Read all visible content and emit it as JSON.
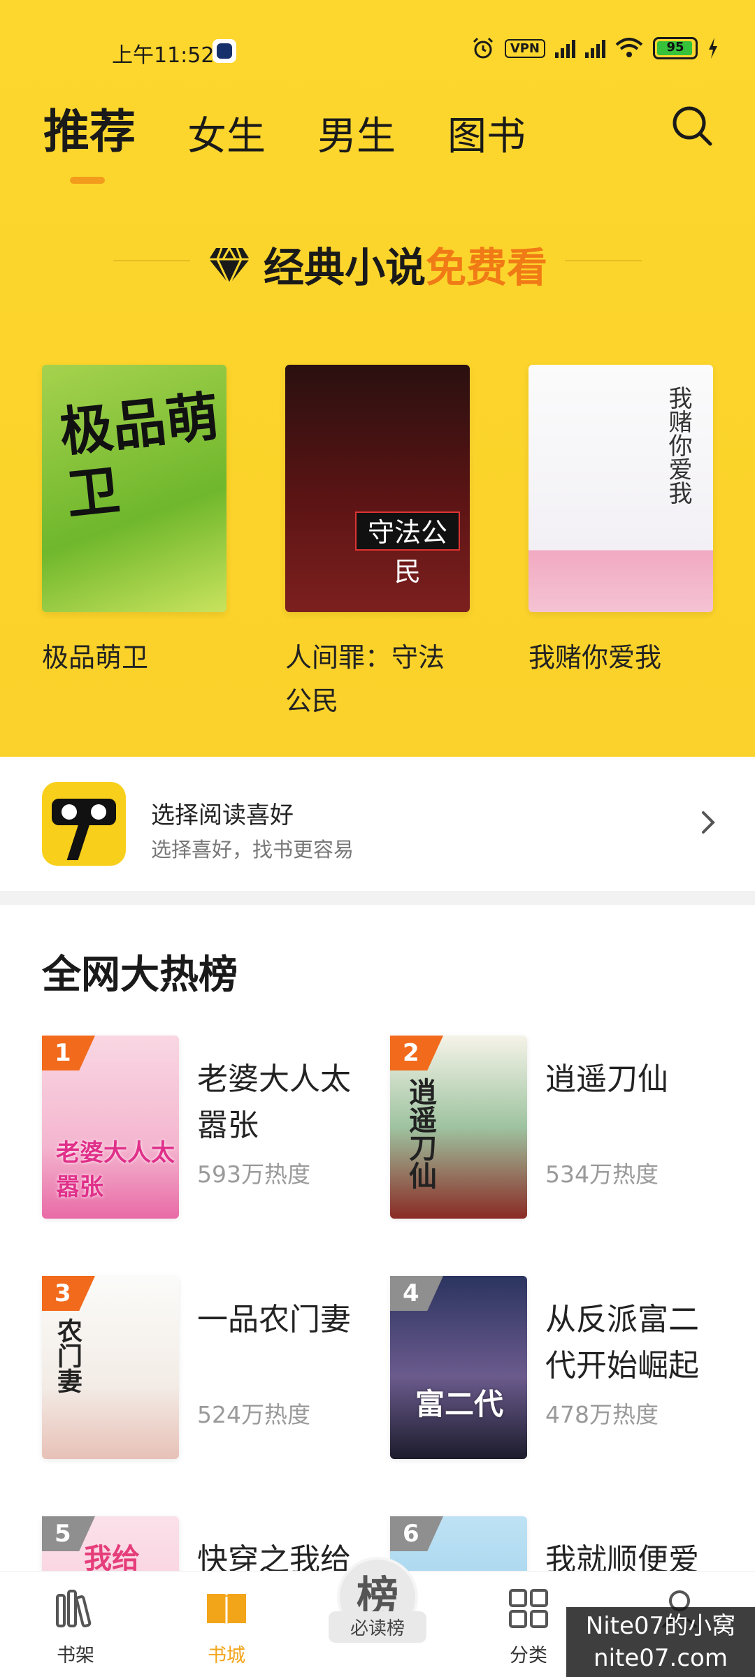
{
  "status": {
    "time": "上午11:52",
    "vpn": "VPN",
    "battery": "95"
  },
  "nav": {
    "tabs": [
      "推荐",
      "女生",
      "男生",
      "图书"
    ]
  },
  "promo": {
    "text_main": "经典小说",
    "text_highlight": "免费看"
  },
  "featured": [
    {
      "title": "极品萌卫",
      "cover_text": "极品萌卫"
    },
    {
      "title": "人间罪：守法公民",
      "cover_text": "守法公民"
    },
    {
      "title": "我赌你爱我",
      "cover_text": "我赌你爱我"
    }
  ],
  "preference": {
    "title": "选择阅读喜好",
    "subtitle": "选择喜好，找书更容易"
  },
  "ranking": {
    "title": "全网大热榜",
    "items": [
      {
        "rank": "1",
        "name": "老婆大人太嚣张",
        "heat": "593万热度",
        "cover_text": "老婆大人太嚣张"
      },
      {
        "rank": "2",
        "name": "逍遥刀仙",
        "heat": "534万热度",
        "cover_text": "逍遥刀仙"
      },
      {
        "rank": "3",
        "name": "一品农门妻",
        "heat": "524万热度",
        "cover_text": "农门妻"
      },
      {
        "rank": "4",
        "name": "从反派富二代开始崛起",
        "heat": "478万热度",
        "cover_text": "富二代"
      },
      {
        "rank": "5",
        "name": "快穿之我给",
        "heat": "",
        "cover_text": "我给"
      },
      {
        "rank": "6",
        "name": "我就顺便爱",
        "heat": "",
        "cover_text": ""
      }
    ]
  },
  "bottom_nav": {
    "bookshelf": "书架",
    "bookstore": "书城",
    "must_read_icon": "榜",
    "must_read": "必读榜",
    "category": "分类"
  },
  "watermark": {
    "line1": "Nite07的小窝",
    "line2": "nite07.com"
  },
  "colors": {
    "brand_yellow": "#fdd72e",
    "accent_orange": "#f07a16",
    "rank_badge": "#f26a1c",
    "active_tab": "#f3a51a"
  }
}
